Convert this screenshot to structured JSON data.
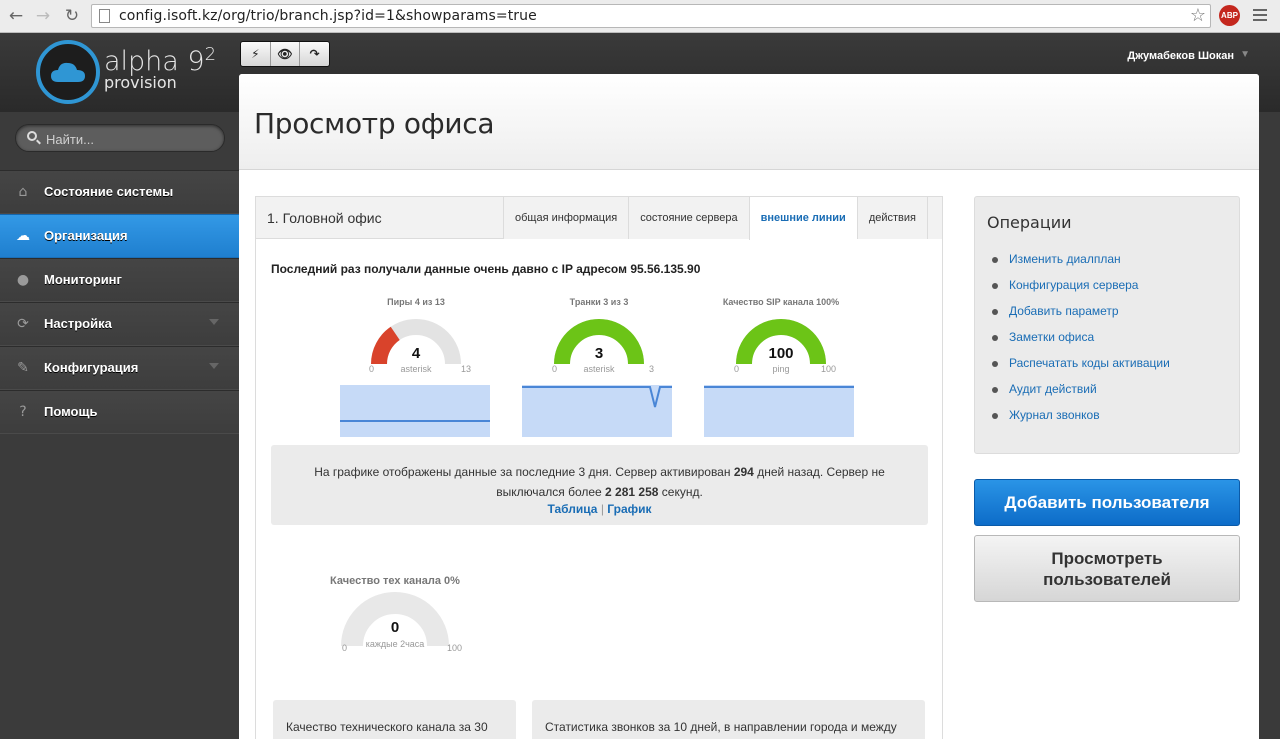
{
  "browser": {
    "url": "config.isoft.kz/org/trio/branch.jsp?id=1&showparams=true",
    "back_icon": "back-arrow",
    "forward_icon": "forward-arrow",
    "reload_icon": "reload",
    "abp_label": "ABP"
  },
  "header": {
    "logo_text": "alpha 9",
    "logo_superscript": "2",
    "logo_subtitle": "provision",
    "user_name": "Джумабеков Шокан",
    "toolbar": [
      "⚡",
      "👁",
      "↷"
    ]
  },
  "sidebar": {
    "search_placeholder": "Найти...",
    "items": [
      {
        "label": "Состояние системы",
        "icon": "⌂",
        "active": false,
        "caret": false
      },
      {
        "label": "Организация",
        "icon": "☁",
        "active": true,
        "caret": false
      },
      {
        "label": "Мониторинг",
        "icon": "●",
        "active": false,
        "caret": false
      },
      {
        "label": "Настройка",
        "icon": "⟳",
        "active": false,
        "caret": true
      },
      {
        "label": "Конфигурация",
        "icon": "✎",
        "active": false,
        "caret": true
      },
      {
        "label": "Помощь",
        "icon": "?",
        "active": false,
        "caret": false
      }
    ]
  },
  "main": {
    "page_title": "Просмотр офиса",
    "office_title": "1. Головной офис",
    "tabs": [
      "общая информация",
      "состояние сервера",
      "внешние линии",
      "действия"
    ],
    "last_data": "Последний раз получали данные очень давно с IP адресом 95.56.135.90",
    "gauges": [
      {
        "label": "Пиры 4 из 13",
        "value": "4",
        "unit": "asterisk",
        "min": "0",
        "max": "13",
        "fraction": 0.31,
        "color": "#d9432b"
      },
      {
        "label": "Транки 3 из 3",
        "value": "3",
        "unit": "asterisk",
        "min": "0",
        "max": "3",
        "fraction": 1.0,
        "color": "#6cc417"
      },
      {
        "label": "Качество SIP канала 100%",
        "value": "100",
        "unit": "ping",
        "min": "0",
        "max": "100",
        "fraction": 1.0,
        "color": "#6cc417"
      },
      {
        "label": "Качество тех канала 0%",
        "value": "0",
        "unit": "каждые 2часа",
        "min": "0",
        "max": "100",
        "fraction": 0.0,
        "color": "#6cc417"
      }
    ],
    "info": {
      "text_part1": "На графике отображены данные за последние 3 дня. Сервер активирован ",
      "days": "294",
      "text_part2": " дней назад. Сервер не выключался более ",
      "seconds": "2 281 258",
      "text_part3": " секунд.",
      "link_table": "Таблица",
      "separator": "|",
      "link_graph": "График"
    },
    "bottom_cards": [
      "Качество технического канала за 30",
      "Статистика звонков за 10 дней, в направлении города и между"
    ]
  },
  "operations": {
    "title": "Операции",
    "links": [
      "Изменить диалплан",
      "Конфигурация сервера",
      "Добавить параметр",
      "Заметки офиса",
      "Распечатать коды активации",
      "Аудит действий",
      "Журнал звонков"
    ]
  },
  "buttons": {
    "add_user": "Добавить пользователя",
    "view_users_line1": "Просмотреть",
    "view_users_line2": "пользователей"
  },
  "colors": {
    "accent": "#1f7fcf",
    "link": "#1a6db5",
    "gauge_green": "#6cc417",
    "gauge_red": "#d9432b"
  }
}
